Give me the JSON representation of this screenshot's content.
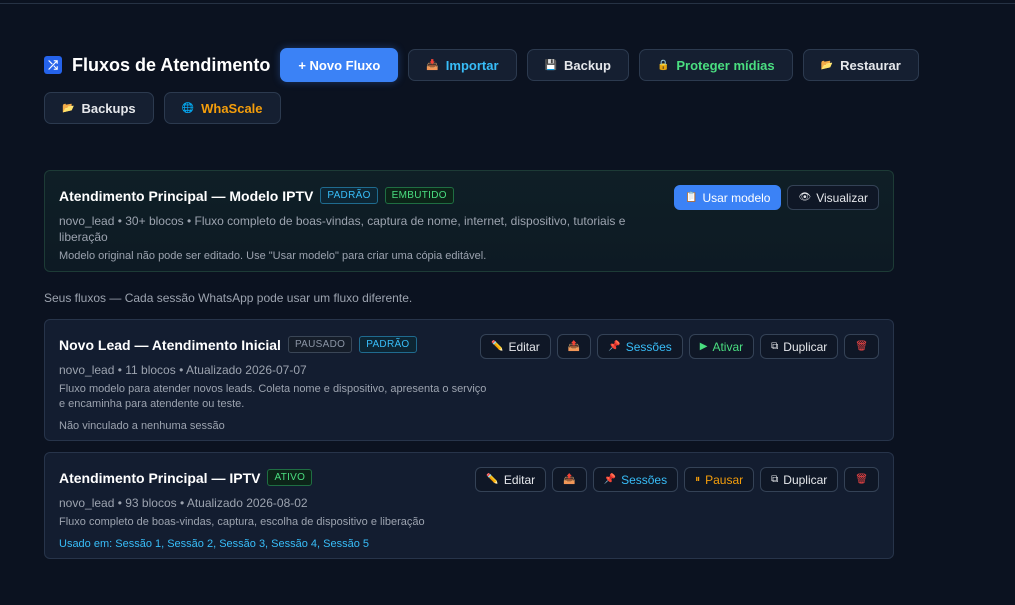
{
  "header": {
    "title": "Fluxos de Atendimento",
    "buttons": {
      "new_flow": "+ Novo Fluxo",
      "import": "Importar",
      "backup": "Backup",
      "protect": "Proteger mídias",
      "restore": "Restaurar",
      "backups": "Backups",
      "whascale": "WhaScale"
    }
  },
  "model": {
    "title": "Atendimento Principal — Modelo IPTV",
    "badges": [
      "PADRÃO",
      "EMBUTIDO"
    ],
    "meta": "novo_lead • 30+ blocos • Fluxo completo de boas-vindas, captura de nome, internet, dispositivo, tutoriais e liberação",
    "note": "Modelo original não pode ser editado. Use \"Usar modelo\" para criar uma cópia editável.",
    "use_label": "Usar modelo",
    "view_label": "Visualizar"
  },
  "section_label": "Seus fluxos — Cada sessão WhatsApp pode usar um fluxo diferente.",
  "flows": [
    {
      "title": "Novo Lead — Atendimento Inicial",
      "badges": [
        "PAUSADO",
        "PADRÃO"
      ],
      "meta": "novo_lead • 11 blocos • Atualizado 2026-07-07",
      "desc": "Fluxo modelo para atender novos leads. Coleta nome e dispositivo, apresenta o serviço e encaminha para atendente ou teste.",
      "usage": "Não vinculado a nenhuma sessão",
      "actions": {
        "edit": "Editar",
        "sessions": "Sessões",
        "toggle": "Ativar",
        "duplicate": "Duplicar"
      }
    },
    {
      "title": "Atendimento Principal — IPTV",
      "badges": [
        "ATIVO"
      ],
      "meta": "novo_lead • 93 blocos • Atualizado 2026-08-02",
      "desc": "Fluxo completo de boas-vindas, captura, escolha de dispositivo e liberação",
      "usage": "Usado em: Sessão 1, Sessão 2, Sessão 3, Sessão 4, Sessão 5",
      "actions": {
        "edit": "Editar",
        "sessions": "Sessões",
        "toggle": "Pausar",
        "duplicate": "Duplicar"
      }
    }
  ],
  "colors": {
    "accent": "#3b82f6",
    "green": "#4ade80",
    "orange": "#f59e0b",
    "cyan": "#38bdf8",
    "danger": "#ef4444"
  }
}
